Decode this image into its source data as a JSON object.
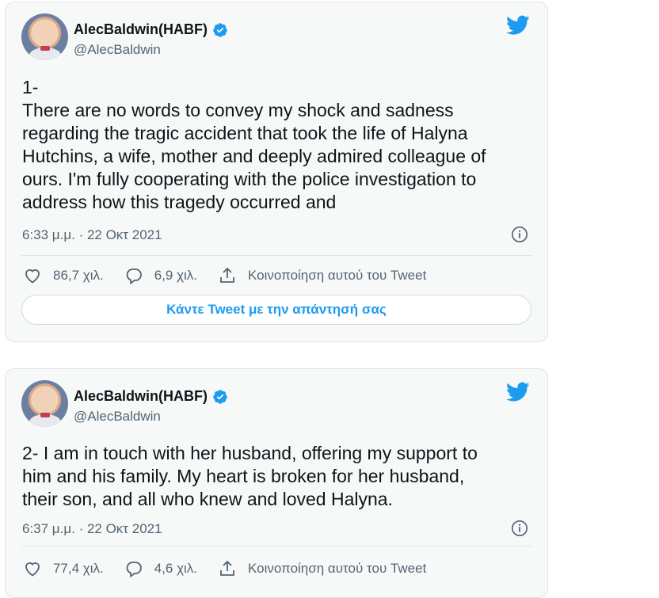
{
  "colors": {
    "accent": "#1d9bf0",
    "muted": "#536471",
    "text": "#0f1419"
  },
  "tweets": [
    {
      "display_name": "AlecBaldwin(HABF)",
      "handle": "@AlecBaldwin",
      "text": "1-\nThere are no words to convey my shock and sadness\nregarding the tragic accident that took the life of Halyna\nHutchins, a wife, mother and deeply admired colleague of\nours. I'm fully cooperating with the police investigation to\naddress how this tragedy occurred and",
      "timestamp": "6:33 μ.μ. · 22 Οκτ 2021",
      "likes": "86,7 χιλ.",
      "replies": "6,9 χιλ.",
      "share_label": "Κοινοποίηση αυτού του Tweet",
      "reply_button_label": "Κάντε Tweet με την απάντησή σας"
    },
    {
      "display_name": "AlecBaldwin(HABF)",
      "handle": "@AlecBaldwin",
      "text": "2- I am in touch with her husband, offering my support to\nhim and his family. My heart is broken for her husband,\ntheir son, and all who knew and loved Halyna.",
      "timestamp": "6:37 μ.μ. · 22 Οκτ 2021",
      "likes": "77,4 χιλ.",
      "replies": "4,6 χιλ.",
      "share_label": "Κοινοποίηση αυτού του Tweet"
    }
  ],
  "icons": [
    "avatar",
    "verified-badge-icon",
    "twitter-bird-icon",
    "info-icon",
    "heart-icon",
    "reply-icon",
    "share-icon"
  ]
}
